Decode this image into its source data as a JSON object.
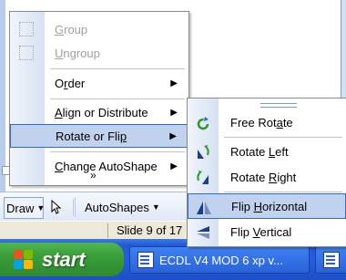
{
  "draw_menu": {
    "items": [
      {
        "label": "Group",
        "accel_index": 0,
        "enabled": false,
        "icon": "group-icon"
      },
      {
        "label": "Ungroup",
        "accel_index": 0,
        "enabled": false,
        "icon": "ungroup-icon"
      },
      {
        "label": "Order",
        "accel_index": 1,
        "has_submenu": true
      },
      {
        "label": "Align or Distribute",
        "accel_index": 0,
        "has_submenu": true
      },
      {
        "label": "Rotate or Flip",
        "accel_index": 13,
        "has_submenu": true,
        "highlighted": true
      },
      {
        "label": "Change AutoShape",
        "accel_index": 0,
        "has_submenu": true
      }
    ],
    "more_glyph": "»"
  },
  "rotate_submenu": {
    "items": [
      {
        "label": "Free Rotate",
        "accel_index": 8,
        "icon": "free-rotate-icon"
      },
      {
        "label": "Rotate Left",
        "accel_index": 7,
        "icon": "rotate-left-icon"
      },
      {
        "label": "Rotate Right",
        "accel_index": 7,
        "icon": "rotate-right-icon"
      },
      {
        "label": "Flip Horizontal",
        "accel_index": 5,
        "icon": "flip-horizontal-icon",
        "highlighted": true
      },
      {
        "label": "Flip Vertical",
        "accel_index": 5,
        "icon": "flip-vertical-icon"
      }
    ]
  },
  "draw_toolbar": {
    "draw_label": "Draw",
    "autoshapes_label": "AutoShapes",
    "cursor_icon": "select-objects-icon"
  },
  "status_bar": {
    "slide_text": "Slide 9 of 17"
  },
  "taskbar": {
    "start_label": "start",
    "tasks": [
      {
        "label": "ECDL V4 MOD 6 xp v...",
        "icon": "powerpoint-doc-icon"
      },
      {
        "label": "",
        "icon": "powerpoint-doc-icon"
      }
    ]
  },
  "colors": {
    "menu_highlight": "#c1d2ee",
    "menu_highlight_border": "#316ac5",
    "taskbar_blue": "#245edb",
    "start_green": "#3a9d3a"
  }
}
